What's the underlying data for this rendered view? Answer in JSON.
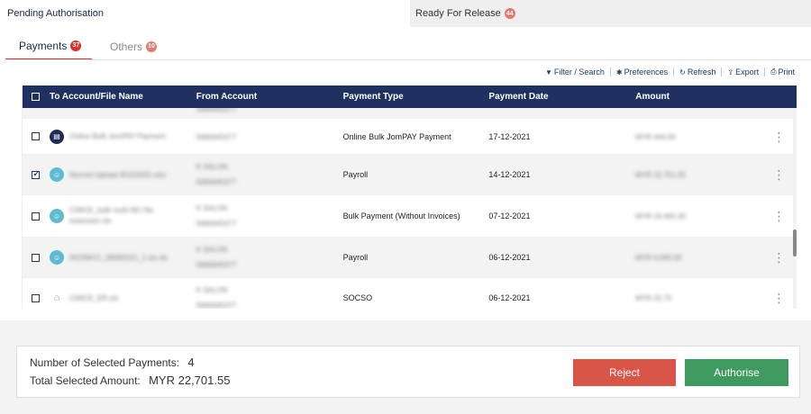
{
  "top_tabs": [
    {
      "label": "Pending Authorisation",
      "badge": ""
    },
    {
      "label": "Ready For Release",
      "badge": "44"
    }
  ],
  "sub_tabs": [
    {
      "label": "Payments",
      "badge": "37"
    },
    {
      "label": "Others",
      "badge": "10"
    }
  ],
  "toolbar": {
    "filter": "Filter / Search",
    "preferences": "Preferences",
    "refresh": "Refresh",
    "export": "Export",
    "print": "Print"
  },
  "table": {
    "headers": {
      "to": "To Account/File Name",
      "from": "From Account",
      "type": "Payment Type",
      "date": "Payment Date",
      "amount": "Amount"
    },
    "rows": [
      {
        "name": "Online Bulk JomPAY Payment",
        "from_name": "",
        "from_acct": "5690645377",
        "type": "Online Bulk JomPAY Payment",
        "date": "17-12-2021",
        "amount": "MYR 444.00",
        "checked": false,
        "icon": "jompay-icon"
      },
      {
        "name": "Normal Upload 30102022.xlsx",
        "from_name": "K SALON",
        "from_acct": "5690645377",
        "type": "Payroll",
        "date": "14-12-2021",
        "amount": "MYR 22,701.55",
        "checked": true,
        "icon": "payroll-icon"
      },
      {
        "name": "CIWCE_bulk multi 061 file extension.xls",
        "from_name": "K SALON",
        "from_acct": "5690645377",
        "type": "Bulk Payment (Without Invoices)",
        "date": "07-12-2021",
        "amount": "MYR 24,065.30",
        "checked": false,
        "icon": "bulk-payment-icon"
      },
      {
        "name": "IN23WCC_06082021_1.xls.xls",
        "from_name": "K SALON",
        "from_acct": "5690645377",
        "type": "Payroll",
        "date": "06-12-2021",
        "amount": "MYR 6,000.00",
        "checked": false,
        "icon": "payroll-icon"
      },
      {
        "name": "CIWCE_ER.xls",
        "from_name": "K SALON",
        "from_acct": "5690645377",
        "type": "SOCSO",
        "date": "06-12-2021",
        "amount": "MYR 22.70",
        "checked": false,
        "icon": "socso-icon"
      }
    ]
  },
  "summary": {
    "count_label": "Number of Selected Payments:",
    "count_value": "4",
    "total_label": "Total Selected Amount:",
    "total_value": "MYR 22,701.55"
  },
  "buttons": {
    "reject": "Reject",
    "authorise": "Authorise"
  },
  "colors": {
    "header": "#1f3160",
    "accent_red": "#d9342b",
    "reject": "#d95548",
    "authorise": "#3f9a5f"
  }
}
